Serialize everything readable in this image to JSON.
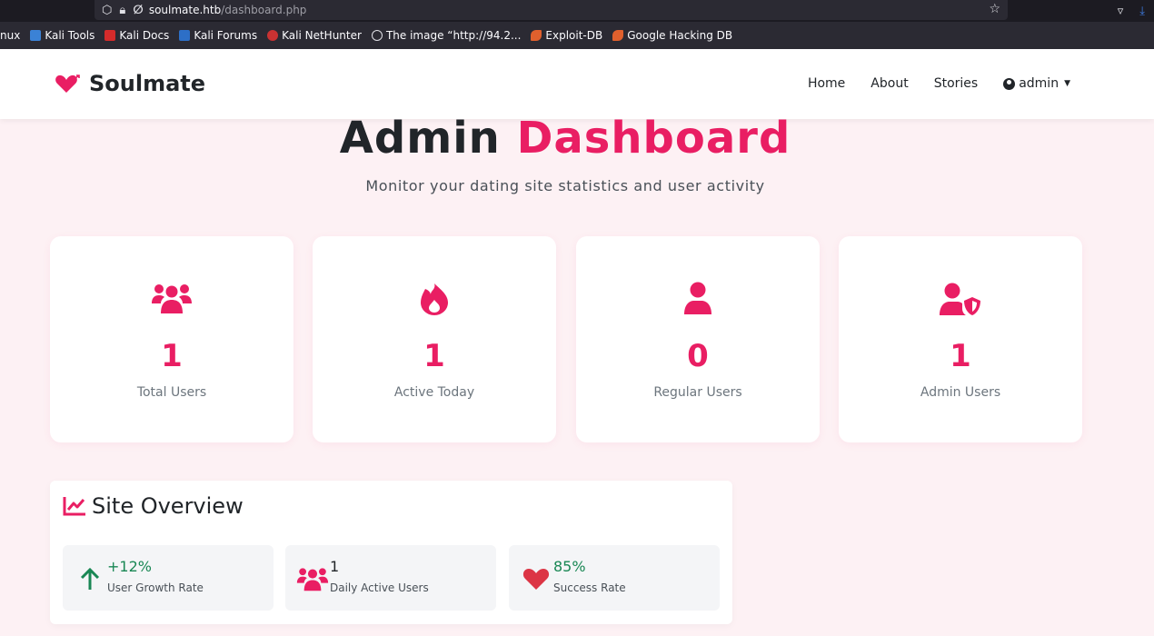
{
  "browser": {
    "url_host": "soulmate.htb",
    "url_path": "/dashboard.php",
    "bookmarks": [
      "nux",
      "Kali Tools",
      "Kali Docs",
      "Kali Forums",
      "Kali NetHunter",
      "The image “http://94.2...",
      "Exploit-DB",
      "Google Hacking DB"
    ]
  },
  "nav": {
    "brand": "Soulmate",
    "links": [
      "Home",
      "About",
      "Stories"
    ],
    "user": "admin"
  },
  "hero": {
    "title_part1": "Admin",
    "title_part2": "Dashboard",
    "subtitle": "Monitor your dating site statistics and user activity"
  },
  "stats": [
    {
      "value": "1",
      "label": "Total Users",
      "icon": "users-icon"
    },
    {
      "value": "1",
      "label": "Active Today",
      "icon": "fire-icon"
    },
    {
      "value": "0",
      "label": "Regular Users",
      "icon": "user-icon"
    },
    {
      "value": "1",
      "label": "Admin Users",
      "icon": "user-shield-icon"
    }
  ],
  "overview": {
    "title": "Site Overview",
    "items": [
      {
        "value": "+12%",
        "label": "User Growth Rate",
        "icon": "arrow-up-icon",
        "color": "#198754"
      },
      {
        "value": "1",
        "label": "Daily Active Users",
        "icon": "users-icon",
        "color": "#212529"
      },
      {
        "value": "85%",
        "label": "Success Rate",
        "icon": "heart-icon",
        "color": "#198754"
      }
    ]
  },
  "colors": {
    "accent": "#e91e63",
    "success": "#198754",
    "heart": "#dc3545"
  }
}
